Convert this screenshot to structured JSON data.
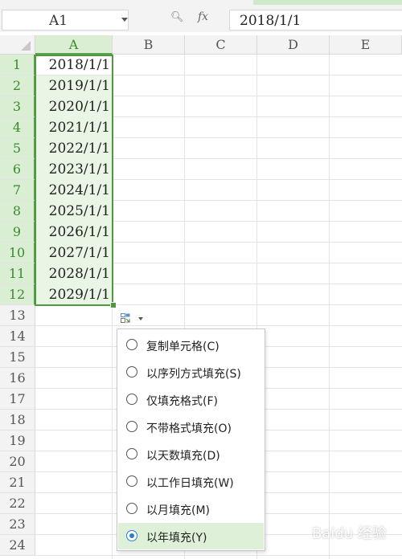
{
  "formula_bar": {
    "cell_ref": "A1",
    "fx_label": "fx",
    "formula_value": "2018/1/1"
  },
  "columns": [
    "A",
    "B",
    "C",
    "D",
    "E"
  ],
  "selected_column": "A",
  "rows": [
    "1",
    "2",
    "3",
    "4",
    "5",
    "6",
    "7",
    "8",
    "9",
    "10",
    "11",
    "12",
    "13",
    "14",
    "15",
    "16",
    "17",
    "18",
    "19",
    "20",
    "21",
    "22",
    "23",
    "24"
  ],
  "cells_A": [
    "2018/1/1",
    "2019/1/1",
    "2020/1/1",
    "2021/1/1",
    "2022/1/1",
    "2023/1/1",
    "2024/1/1",
    "2025/1/1",
    "2026/1/1",
    "2027/1/1",
    "2028/1/1",
    "2029/1/1"
  ],
  "autofill_menu": {
    "items": [
      {
        "label": "复制单元格(C)",
        "checked": false
      },
      {
        "label": "以序列方式填充(S)",
        "checked": false
      },
      {
        "label": "仅填充格式(F)",
        "checked": false
      },
      {
        "label": "不带格式填充(O)",
        "checked": false
      },
      {
        "label": "以天数填充(D)",
        "checked": false
      },
      {
        "label": "以工作日填充(W)",
        "checked": false
      },
      {
        "label": "以月填充(M)",
        "checked": false
      },
      {
        "label": "以年填充(Y)",
        "checked": true
      }
    ]
  },
  "colors": {
    "selection_green": "#4f9a3e",
    "header_selected": "#d9eed3",
    "radio_blue": "#2a7cd3"
  },
  "watermark": "Baidu 经验"
}
